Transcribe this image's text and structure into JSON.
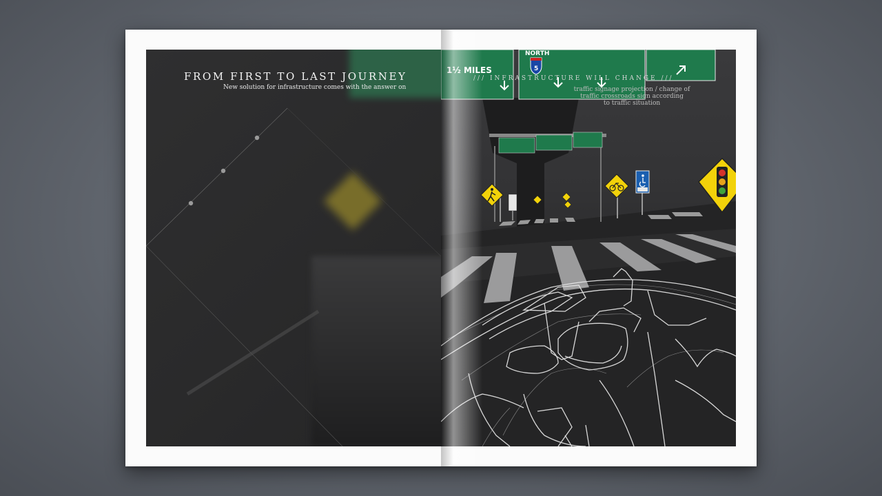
{
  "left_page": {
    "title": "FROM FIRST TO LAST JOURNEY",
    "subtitle": "New solution for infrastructure comes with the answer on"
  },
  "right_page": {
    "heading": "/// INFRASTRUCTURE WILL CHANGE ///",
    "caption_lines": [
      "traffic signage projection / change of",
      "traffic crossroads sign according",
      "to  traffic situation"
    ]
  },
  "overhead_signs": {
    "distance": "1½ MILES",
    "direction": "NORTH",
    "route": "5"
  },
  "colors": {
    "background": "#5f646c",
    "paper": "#fbfbfb",
    "artwork": "#2b2b2c",
    "sign_green": "#1f7a4c",
    "warning_yellow": "#f2d20a"
  },
  "icons": [
    "pedestrian-crossing-sign-icon",
    "bicycle-sign-icon",
    "accessible-parking-sign-icon",
    "traffic-light-sign-icon",
    "interstate-shield-icon",
    "down-arrow-icon",
    "diagonal-arrow-icon"
  ]
}
